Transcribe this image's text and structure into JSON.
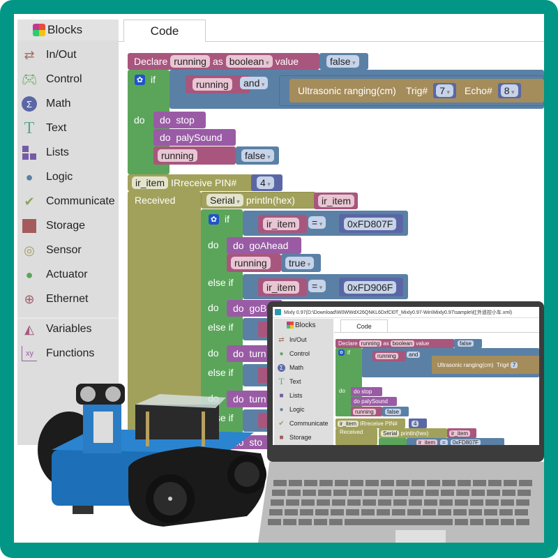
{
  "sidebar": {
    "header": "Blocks",
    "items": [
      {
        "label": "In/Out",
        "icon": "arrows-icon",
        "color": "#a0705a"
      },
      {
        "label": "Control",
        "icon": "gamepad-icon",
        "color": "#5ba55b"
      },
      {
        "label": "Math",
        "icon": "sigma-icon",
        "color": "#5b67a5"
      },
      {
        "label": "Text",
        "icon": "text-t-icon",
        "color": "#5ba58c"
      },
      {
        "label": "Lists",
        "icon": "lists-icon",
        "color": "#745ba5"
      },
      {
        "label": "Logic",
        "icon": "bulb-icon",
        "color": "#5b80a5"
      },
      {
        "label": "Communicate",
        "icon": "bird-icon",
        "color": "#8ca55b"
      },
      {
        "label": "Storage",
        "icon": "floppy-icon",
        "color": "#a55b5b"
      },
      {
        "label": "Sensor",
        "icon": "sensor-icon",
        "color": "#a5995b"
      },
      {
        "label": "Actuator",
        "icon": "actuator-icon",
        "color": "#5ba55b"
      },
      {
        "label": "Ethernet",
        "icon": "globe-icon",
        "color": "#a55b6b"
      },
      {
        "label": "Variables",
        "icon": "variables-icon",
        "color": "#a55b80"
      },
      {
        "label": "Functions",
        "icon": "functions-icon",
        "color": "#9a5ba5"
      }
    ]
  },
  "tabs": {
    "code": "Code"
  },
  "workspace": {
    "declare": {
      "kw": "Declare",
      "var": "running",
      "as": "as",
      "type": "boolean",
      "value_kw": "value",
      "value": "false"
    },
    "if1": {
      "if": "if",
      "var": "running",
      "op": "and",
      "sensor": "Ultrasonic ranging(cm)",
      "trig_kw": "Trig#",
      "trig": "7",
      "echo_kw": "Echo#",
      "echo": "8",
      "do": "do",
      "stmts": [
        {
          "do": "do",
          "name": "stop"
        },
        {
          "do": "do",
          "name": "palySound"
        }
      ],
      "assign": {
        "var": "running",
        "value": "false"
      }
    },
    "ir": {
      "var": "ir_item",
      "kw": "IRreceive PIN#",
      "pin": "4",
      "received": "Received",
      "serial": "Serial",
      "println": "println(hex)",
      "print_var": "ir_item",
      "if": "if",
      "do": "do",
      "elseif": "else if",
      "cond1": {
        "var": "ir_item",
        "op": "=",
        "value": "0xFD807F"
      },
      "do1": {
        "do": "do",
        "name": "goAhead"
      },
      "assign1": {
        "var": "running",
        "value": "true"
      },
      "cond2": {
        "var": "ir_item",
        "op": "=",
        "value": "0xFD906F"
      },
      "do2": {
        "do": "do",
        "name": "goB"
      },
      "do3": {
        "do": "do",
        "name": "turn"
      },
      "do4": {
        "do": "do",
        "name": "turn"
      },
      "do5": {
        "do": "do",
        "name": "sto"
      }
    }
  },
  "laptop": {
    "window_title": "Mixly 0.97(D:\\Download\\W0WWdX26QNKL6DxfCl0T_Mixly0.97-Win\\Mixly0.97\\sample\\红外遥控小车.xml)",
    "sidebar_header": "Blocks",
    "sidebar_items": [
      "In/Out",
      "Control",
      "Math",
      "Text",
      "Lists",
      "Logic",
      "Communicate",
      "Storage"
    ],
    "tab": "Code"
  }
}
